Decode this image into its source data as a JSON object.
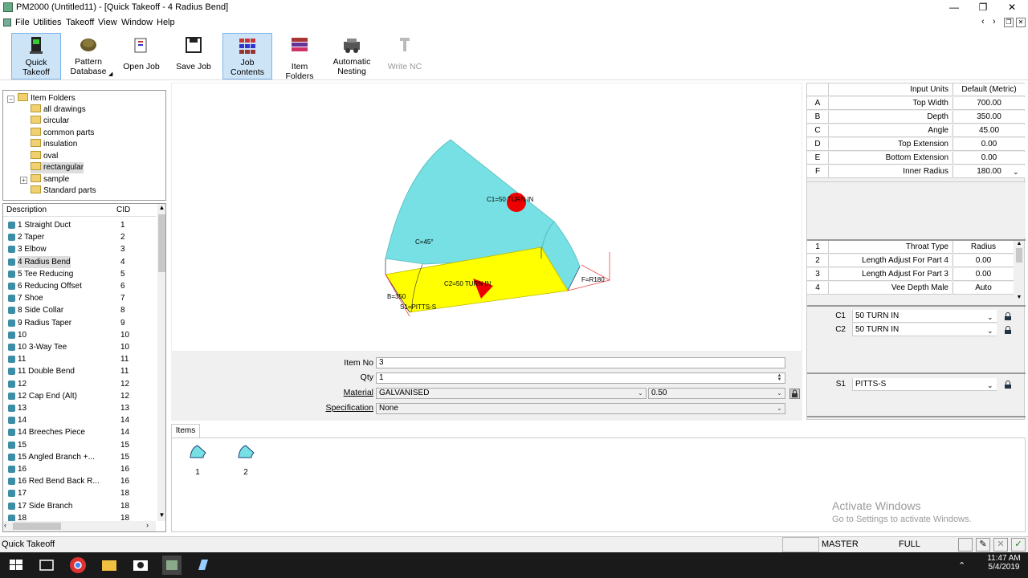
{
  "window": {
    "title": "PM2000 (Untitled11) - [Quick Takeoff - 4 Radius Bend]",
    "min": "—",
    "max": "❐",
    "close": "✕"
  },
  "menu": [
    "File",
    "Utilities",
    "Takeoff",
    "View",
    "Window",
    "Help"
  ],
  "toolbar": [
    {
      "label": "Quick Takeoff",
      "icon": "quick-takeoff-icon"
    },
    {
      "label": "Pattern Database",
      "icon": "pattern-database-icon"
    },
    {
      "label": "Open Job",
      "icon": "open-job-icon"
    },
    {
      "label": "Save Job",
      "icon": "save-job-icon"
    },
    {
      "label": "Job Contents",
      "icon": "job-contents-icon"
    },
    {
      "label": "Item Folders",
      "icon": "item-folders-icon"
    },
    {
      "label": "Automatic Nesting",
      "icon": "automatic-nesting-icon"
    },
    {
      "label": "Write NC",
      "icon": "write-nc-icon"
    }
  ],
  "folders": {
    "root": "Item Folders",
    "items": [
      "all drawings",
      "circular",
      "common parts",
      "insulation",
      "oval",
      "rectangular",
      "sample",
      "Standard parts"
    ],
    "selected": "rectangular"
  },
  "desc_list": {
    "headers": {
      "description": "Description",
      "cid": "CID"
    },
    "rows": [
      {
        "label": "1 Straight Duct",
        "cid": "1"
      },
      {
        "label": "2 Taper",
        "cid": "2"
      },
      {
        "label": "3 Elbow",
        "cid": "3"
      },
      {
        "label": "4 Radius Bend",
        "cid": "4"
      },
      {
        "label": "5 Tee Reducing",
        "cid": "5"
      },
      {
        "label": "6 Reducing Offset",
        "cid": "6"
      },
      {
        "label": "7 Shoe",
        "cid": "7"
      },
      {
        "label": "8 Side Collar",
        "cid": "8"
      },
      {
        "label": "9 Radius Taper",
        "cid": "9"
      },
      {
        "label": "10",
        "cid": "10"
      },
      {
        "label": "10 3-Way Tee",
        "cid": "10"
      },
      {
        "label": "11",
        "cid": "11"
      },
      {
        "label": "11 Double Bend",
        "cid": "11"
      },
      {
        "label": "12",
        "cid": "12"
      },
      {
        "label": "12 Cap End (Alt)",
        "cid": "12"
      },
      {
        "label": "13",
        "cid": "13"
      },
      {
        "label": "14",
        "cid": "14"
      },
      {
        "label": "14 Breeches Piece",
        "cid": "14"
      },
      {
        "label": "15",
        "cid": "15"
      },
      {
        "label": "15 Angled Branch +...",
        "cid": "15"
      },
      {
        "label": "16",
        "cid": "16"
      },
      {
        "label": "16 Red Bend Back R...",
        "cid": "16"
      },
      {
        "label": "17",
        "cid": "18"
      },
      {
        "label": "17 Side Branch",
        "cid": "18"
      },
      {
        "label": "18",
        "cid": "18"
      }
    ],
    "selected_index": 3
  },
  "drawing": {
    "c1": "C1=50 TURN IN",
    "c2": "C2=50 TURN IN",
    "c": "C=45°",
    "b": "B=350",
    "s1": "S1=PITTS-S",
    "f": "F=R180",
    "colors": {
      "top": "#76e0e4",
      "side": "#ffff00",
      "marker": "#e00000"
    }
  },
  "form": {
    "item_no_label": "Item No",
    "item_no": "3",
    "qty_label": "Qty",
    "qty": "1",
    "material_label": "Material",
    "material": "GALVANISED",
    "gauge": "0.50",
    "spec_label": "Specification",
    "spec": "None"
  },
  "items_tab": {
    "label": "Items",
    "thumbs": [
      "1",
      "2"
    ]
  },
  "props": {
    "header": {
      "name": "Input Units",
      "value": "Default (Metric)"
    },
    "dims": [
      {
        "letter": "A",
        "name": "Top Width",
        "value": "700.00"
      },
      {
        "letter": "B",
        "name": "Depth",
        "value": "350.00"
      },
      {
        "letter": "C",
        "name": "Angle",
        "value": "45.00"
      },
      {
        "letter": "D",
        "name": "Top Extension",
        "value": "0.00"
      },
      {
        "letter": "E",
        "name": "Bottom Extension",
        "value": "0.00"
      },
      {
        "letter": "F",
        "name": "Inner Radius",
        "value": "180.00"
      }
    ],
    "options": [
      {
        "letter": "1",
        "name": "Throat Type",
        "value": "Radius"
      },
      {
        "letter": "2",
        "name": "Length Adjust For Part 4",
        "value": "0.00"
      },
      {
        "letter": "3",
        "name": "Length Adjust For Part 3",
        "value": "0.00"
      },
      {
        "letter": "4",
        "name": "Vee Depth Male",
        "value": "Auto"
      }
    ],
    "connectors": [
      {
        "letter": "C1",
        "value": "50 TURN IN"
      },
      {
        "letter": "C2",
        "value": "50 TURN IN"
      }
    ],
    "seams": [
      {
        "letter": "S1",
        "value": "PITTS-S"
      }
    ]
  },
  "status": {
    "text": "Quick Takeoff",
    "master": "MASTER",
    "full": "FULL"
  },
  "watermark": {
    "line1": "Activate Windows",
    "line2": "Go to Settings to activate Windows."
  },
  "clock": {
    "time": "11:47 AM",
    "date": "5/4/2019"
  }
}
